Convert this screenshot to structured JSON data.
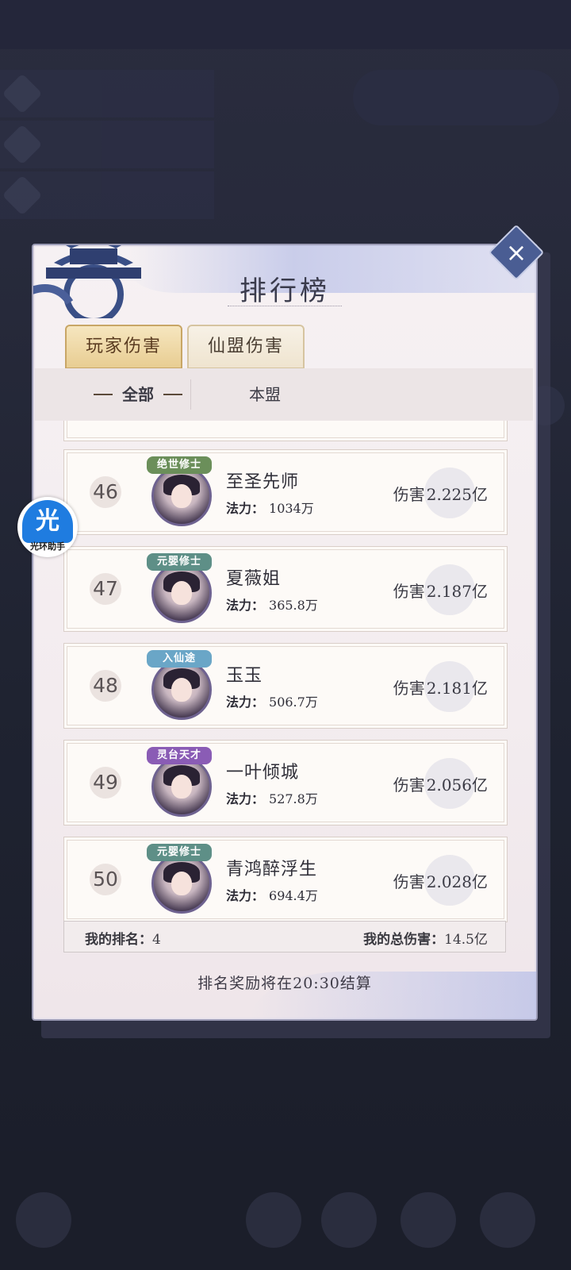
{
  "modal": {
    "title": "排行榜",
    "close_icon": "×",
    "tabs": [
      {
        "label": "玩家伤害",
        "active": true
      },
      {
        "label": "仙盟伤害",
        "active": false
      }
    ],
    "subtabs": [
      {
        "label": "全部",
        "active": true
      },
      {
        "label": "本盟",
        "active": false
      }
    ],
    "power_label": "法力：",
    "damage_label": "伤害",
    "rows": [
      {
        "rank": "46",
        "name": "至圣先师",
        "power": "1034万",
        "damage": "2.225亿",
        "badge": "绝世修士",
        "badge_color": "#6b8f5a"
      },
      {
        "rank": "47",
        "name": "夏薇姐",
        "power": "365.8万",
        "damage": "2.187亿",
        "badge": "元婴修士",
        "badge_color": "#5e8f87"
      },
      {
        "rank": "48",
        "name": "玉玉",
        "power": "506.7万",
        "damage": "2.181亿",
        "badge": "入仙途",
        "badge_color": "#6aa6c7"
      },
      {
        "rank": "49",
        "name": "一叶倾城",
        "power": "527.8万",
        "damage": "2.056亿",
        "badge": "灵台天才",
        "badge_color": "#8a5cb5"
      },
      {
        "rank": "50",
        "name": "青鸿醉浮生",
        "power": "694.4万",
        "damage": "2.028亿",
        "badge": "元婴修士",
        "badge_color": "#5e8f87"
      }
    ],
    "my_rank_label": "我的排名：",
    "my_rank_value": "4",
    "my_damage_label": "我的总伤害：",
    "my_damage_value": "14.5亿",
    "footer": "排名奖励将在20:30结算"
  },
  "assistant": {
    "glyph": "光",
    "caption": "光环助手"
  }
}
